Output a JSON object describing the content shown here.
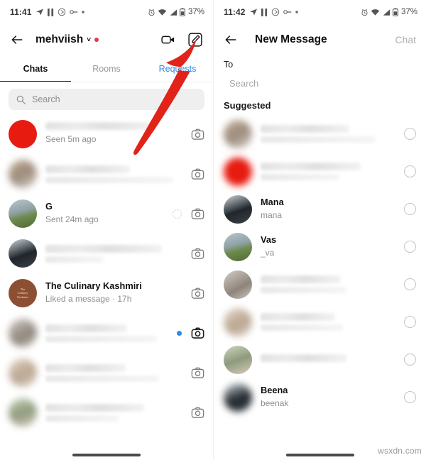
{
  "left": {
    "statusbar": {
      "time": "11:41",
      "icons": [
        "send-icon",
        "pause-icon",
        "play-circle-icon",
        "vpn-key-icon",
        "dot-icon"
      ],
      "right_icons": [
        "alarm-icon",
        "wifi-icon",
        "signal-icon",
        "battery-icon"
      ],
      "battery": "37%"
    },
    "header": {
      "back_icon": "back-arrow-icon",
      "username": "mehviish",
      "chevron": "˅",
      "status_dot": "red",
      "video_icon": "video-camera-icon",
      "compose_icon": "compose-pencil-icon"
    },
    "tabs": [
      {
        "label": "Chats",
        "active": true
      },
      {
        "label": "Rooms",
        "active": false
      },
      {
        "label": "Requests",
        "active": false,
        "highlight": true
      }
    ],
    "search": {
      "placeholder": "Search",
      "icon": "search-icon"
    },
    "rows": [
      {
        "name": "",
        "sub": "Seen 5m ago",
        "name_blurred": true,
        "avatar": "av-red",
        "avatar_blurred": false,
        "unread": false,
        "spinner": false,
        "camera": true
      },
      {
        "name": "",
        "sub": "",
        "name_blurred": true,
        "sub_blurred": true,
        "avatar": "av-bld1",
        "avatar_blurred": true,
        "unread": false,
        "spinner": false,
        "camera": true
      },
      {
        "name": "G",
        "sub": "Sent 24m ago",
        "name_blurred": false,
        "avatar": "av-g",
        "avatar_blurred": false,
        "unread": false,
        "spinner": true,
        "camera": true
      },
      {
        "name": "",
        "sub": "",
        "name_blurred": true,
        "sub_blurred": true,
        "avatar": "av-dark",
        "avatar_blurred": false,
        "unread": false,
        "spinner": false,
        "camera": true
      },
      {
        "name": "The Culinary Kashmiri",
        "sub": "Liked a message · 17h",
        "name_blurred": false,
        "avatar": "av-ck",
        "avatar_blurred": false,
        "unread": false,
        "spinner": false,
        "camera": true
      },
      {
        "name": "",
        "sub": "",
        "name_blurred": true,
        "sub_blurred": true,
        "avatar": "av-bld2",
        "avatar_blurred": true,
        "unread": true,
        "spinner": false,
        "camera": true
      },
      {
        "name": "",
        "sub": "",
        "name_blurred": true,
        "sub_blurred": true,
        "avatar": "av-bld3",
        "avatar_blurred": true,
        "unread": false,
        "spinner": false,
        "camera": true
      },
      {
        "name": "",
        "sub": "",
        "name_blurred": true,
        "sub_blurred": true,
        "avatar": "av-bld4",
        "avatar_blurred": true,
        "unread": false,
        "spinner": false,
        "camera": true
      }
    ],
    "annotation": {
      "type": "red-arrow",
      "points_to": "compose-pencil-icon",
      "color": "#e2231a"
    }
  },
  "right": {
    "statusbar": {
      "time": "11:42",
      "battery": "37%"
    },
    "header": {
      "back_icon": "back-arrow-icon",
      "title": "New Message",
      "action_label": "Chat"
    },
    "to_label": "To",
    "to_placeholder": "Search",
    "section_title": "Suggested",
    "rows": [
      {
        "name": "",
        "sub": "",
        "name_blurred": true,
        "sub_blurred": true,
        "avatar": "av-bld1",
        "avatar_blurred": true
      },
      {
        "name": "",
        "sub": "",
        "name_blurred": true,
        "sub_blurred": true,
        "avatar": "av-red",
        "avatar_blurred": true
      },
      {
        "name": "Mana",
        "sub": "mana",
        "name_blurred": false,
        "partial": true,
        "avatar": "av-dark",
        "avatar_blurred": false
      },
      {
        "name": "Vas",
        "sub": "_va",
        "name_blurred": false,
        "partial": true,
        "avatar": "av-g",
        "avatar_blurred": false
      },
      {
        "name": "",
        "sub": "",
        "name_blurred": true,
        "sub_blurred": true,
        "avatar": "av-bld2",
        "avatar_blurred": false
      },
      {
        "name": "",
        "sub": "",
        "name_blurred": true,
        "sub_blurred": true,
        "avatar": "av-bld3",
        "avatar_blurred": true
      },
      {
        "name": "",
        "sub": "",
        "name_blurred": true,
        "sub_blurred": false,
        "avatar": "av-bld4",
        "avatar_blurred": false
      },
      {
        "name": "Beena",
        "sub": "beenak",
        "name_blurred": false,
        "partial": true,
        "avatar": "av-dark",
        "avatar_blurred": true
      }
    ]
  },
  "watermark": "wsxdn.com"
}
